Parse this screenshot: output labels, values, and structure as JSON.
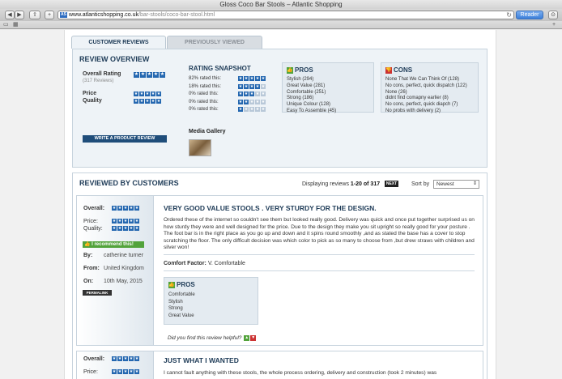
{
  "window": {
    "title": "Gloss Coco Bar Stools – Atlantic Shopping"
  },
  "browser": {
    "url_host": "www.atlanticshopping.co.uk",
    "url_path": "/bar-stools/coco-bar-stool.html",
    "reader_label": "Reader",
    "favicon_text": "AS"
  },
  "tabs": {
    "reviews": "CUSTOMER REVIEWS",
    "viewed": "PREVIOUSLY VIEWED"
  },
  "overview": {
    "title": "REVIEW OVERVIEW",
    "overall_label": "Overall Rating",
    "review_count": "(317 Reviews)",
    "price_label": "Price",
    "quality_label": "Quality",
    "overall_stars": 5,
    "price_stars": 5,
    "quality_stars": 5,
    "write_button": "WRITE A PRODUCT REVIEW",
    "media_gallery": "Media Gallery"
  },
  "snapshot": {
    "title": "RATING SNAPSHOT",
    "rows": [
      {
        "text": "82% rated this:",
        "stars": 5
      },
      {
        "text": "18% rated this:",
        "stars": 4
      },
      {
        "text": "0% rated this:",
        "stars": 3
      },
      {
        "text": "0% rated this:",
        "stars": 2
      },
      {
        "text": "0% rated this:",
        "stars": 1
      }
    ]
  },
  "pros": {
    "title": "PROS",
    "items": [
      "Stylish (294)",
      "Great Value (281)",
      "Comfortable (251)",
      "Strong (186)",
      "Unique Colour (128)",
      "Easy To Assemble (45)"
    ]
  },
  "cons": {
    "title": "CONS",
    "items": [
      "None That We Can Think Of (128)",
      "No cons, perfect, quick dispatch (122)",
      "None (26)",
      "didnt find comapny earlier (8)",
      "No cons, perfect, quick diapch (7)",
      "No probs with delivery (2)"
    ]
  },
  "reviewed": {
    "title": "REVIEWED BY CUSTOMERS",
    "displaying_prefix": "Displaying reviews ",
    "displaying_range": "1-20 of 317",
    "next": "NEXT",
    "sort_label": "Sort by",
    "sort_value": "Newest"
  },
  "review1": {
    "overall_label": "Overall:",
    "price_label": "Price:",
    "quality_label": "Quality:",
    "recommend": "I recommend this!",
    "by_label": "By:",
    "by_value": "catherine turner",
    "from_label": "From:",
    "from_value": "United Kingdom",
    "on_label": "On:",
    "on_value": "10th May, 2015",
    "permalink": "PERMALINK",
    "title": "VERY GOOD VALUE STOOLS . VERY STURDY FOR THE DESIGN.",
    "body": "Ordered these of the internet so couldn't see them but looked really good. Delivery was quick and once put together surprised us on how sturdy they were and well designed for the price. Due to the design they make you sit upright so really good for your posture . The foot bar is in the right place as you go up and down and it spins round smoothly ,and as stated the base has a cover to stop scratching the floor. The only difficult decision was which color to pick as so many to choose from ,but drew straws with children and silver won!",
    "comfort_label": "Comfort Factor:",
    "comfort_value": "V. Comfortable",
    "pros_title": "PROS",
    "pros": [
      "Comfortable",
      "Stylish",
      "Strong",
      "Great Value"
    ],
    "helpful": "Did you find this review helpful?"
  },
  "review2": {
    "overall_label": "Overall:",
    "price_label": "Price:",
    "title": "JUST WHAT I WANTED",
    "body": "I cannot fault anything with these stools, the whole process ordering, delivery and construction (took 2 minutes) was"
  },
  "colors": {
    "navy": "#1e3b57",
    "star_blue": "#2467b0",
    "green": "#52a33b",
    "red": "#cc3333"
  }
}
